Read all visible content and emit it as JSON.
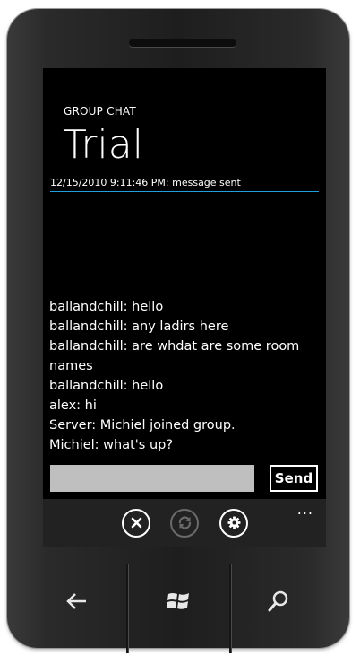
{
  "header": {
    "subtitle": "GROUP CHAT",
    "title": "Trial"
  },
  "status": {
    "text": "12/15/2010 9:11:46 PM: message sent"
  },
  "messages": [
    "ballandchill: hello",
    "ballandchill: any ladirs here",
    "ballandchill: are whdat are some room names",
    "ballandchill: hello",
    "alex: hi",
    "Server: Michiel joined group.",
    "Michiel: what's up?"
  ],
  "compose": {
    "value": "",
    "send_label": "Send"
  },
  "appbar": {
    "buttons": [
      {
        "icon": "close-icon",
        "enabled": true
      },
      {
        "icon": "refresh-icon",
        "enabled": false
      },
      {
        "icon": "settings-icon",
        "enabled": true
      }
    ],
    "ellipsis": "..."
  },
  "hardware": {
    "buttons": [
      "back-icon",
      "windows-start-icon",
      "search-icon"
    ]
  },
  "colors": {
    "accent": "#1ba1e2",
    "screen_bg": "#000000",
    "input_bg": "#bfbfbf",
    "appbar_bg": "#222222"
  }
}
